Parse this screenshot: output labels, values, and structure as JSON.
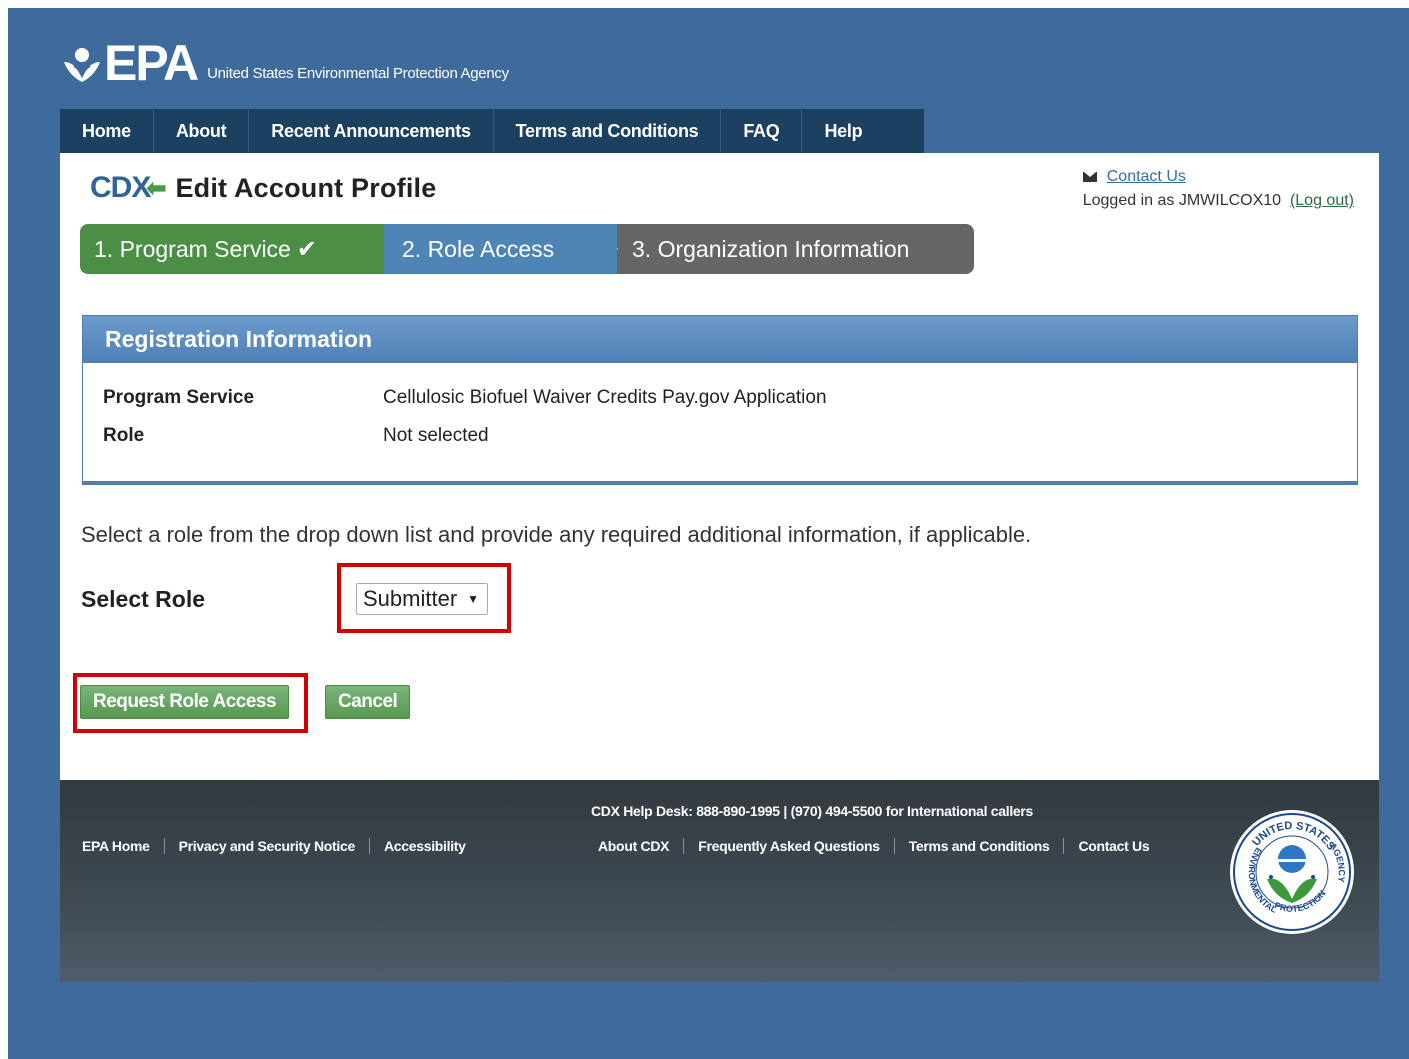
{
  "header": {
    "logo_text": "EPA",
    "agency_name": "United States Environmental Protection Agency"
  },
  "topnav": {
    "items": [
      "Home",
      "About",
      "Recent Announcements",
      "Terms and Conditions",
      "FAQ",
      "Help"
    ]
  },
  "panel": {
    "cdx_logo": "CDX",
    "page_title": "Edit Account Profile",
    "contact_link": "Contact Us",
    "logged_in_prefix": "Logged in as JMWILCOX10",
    "logout_link": "(Log out)"
  },
  "stepper": {
    "steps": [
      {
        "label": "1. Program Service",
        "state": "complete"
      },
      {
        "label": "2. Role Access",
        "state": "active"
      },
      {
        "label": "3. Organization Information",
        "state": "pending"
      }
    ],
    "check": "✔"
  },
  "registration": {
    "title": "Registration Information",
    "rows": [
      {
        "label": "Program Service",
        "value": "Cellulosic Biofuel Waiver Credits Pay.gov Application"
      },
      {
        "label": "Role",
        "value": "Not selected"
      }
    ]
  },
  "form": {
    "instructions": "Select a role from the drop down list and provide any required additional information, if applicable.",
    "select_label": "Select Role",
    "select_value": "Submitter",
    "request_button": "Request Role Access",
    "cancel_button": "Cancel"
  },
  "footer": {
    "helpdesk": "CDX Help Desk: 888-890-1995 | (970) 494-5500 for International callers",
    "left_links": [
      "EPA Home",
      "Privacy and Security Notice",
      "Accessibility"
    ],
    "right_links": [
      "About CDX",
      "Frequently Asked Questions",
      "Terms and Conditions",
      "Contact Us"
    ],
    "seal_top_text": "UNITED STATES",
    "seal_left_text": "ENVIRONMENTAL",
    "seal_bottom_text": "PROTECTION",
    "seal_right_text": "AGENCY"
  },
  "colors": {
    "frame_bg": "#3e6a9c",
    "nav_bg": "#1c4060",
    "step_complete": "#4a8f45",
    "step_active": "#4f84b7",
    "step_pending": "#666666",
    "highlight": "#d20000",
    "button_green": "#57984f"
  }
}
